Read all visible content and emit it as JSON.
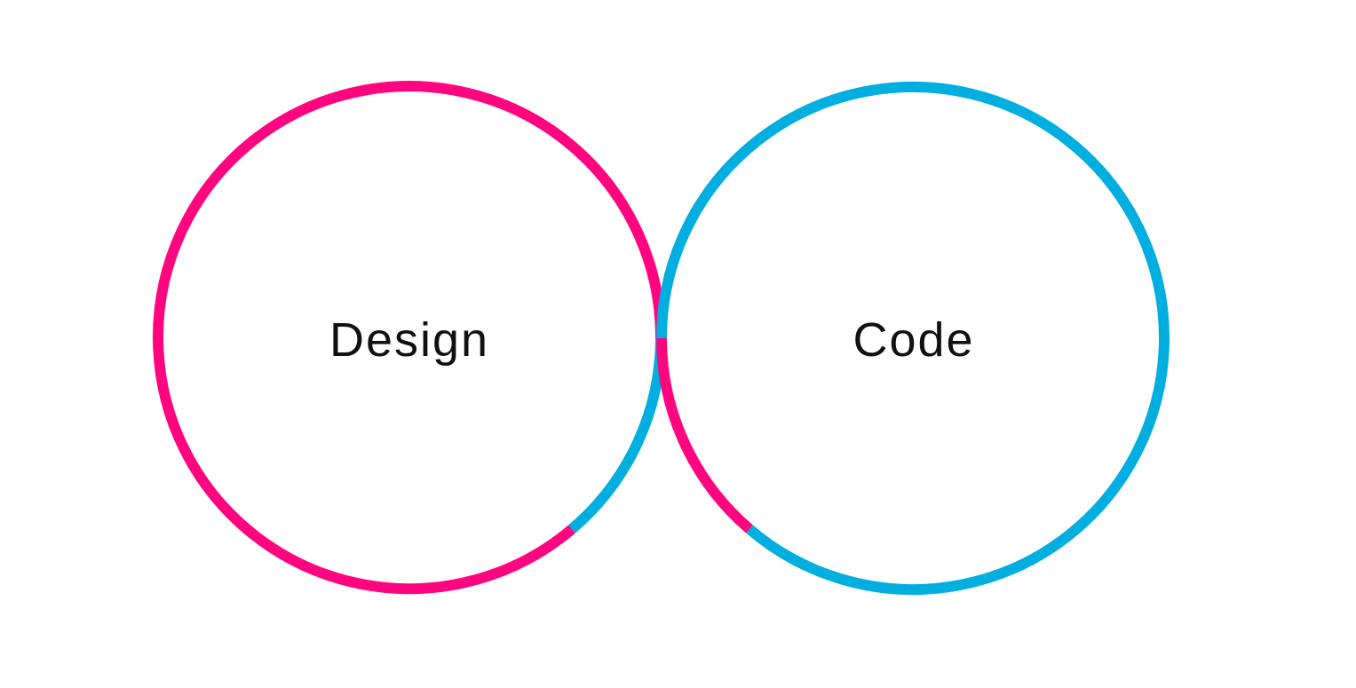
{
  "diagram": {
    "left_circle": {
      "label": "Design",
      "outline_color": "#FF0580"
    },
    "right_circle": {
      "label": "Code",
      "outline_color": "#00AEE0"
    }
  },
  "colors": {
    "background": "#FFFFFF",
    "text": "#111111"
  }
}
